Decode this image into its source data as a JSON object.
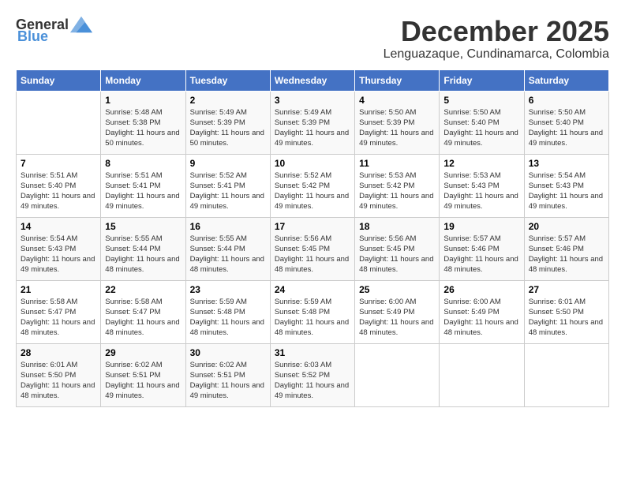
{
  "header": {
    "logo_general": "General",
    "logo_blue": "Blue",
    "month": "December 2025",
    "location": "Lenguazaque, Cundinamarca, Colombia"
  },
  "weekdays": [
    "Sunday",
    "Monday",
    "Tuesday",
    "Wednesday",
    "Thursday",
    "Friday",
    "Saturday"
  ],
  "weeks": [
    [
      {
        "day": "",
        "sunrise": "",
        "sunset": "",
        "daylight": ""
      },
      {
        "day": "1",
        "sunrise": "Sunrise: 5:48 AM",
        "sunset": "Sunset: 5:38 PM",
        "daylight": "Daylight: 11 hours and 50 minutes."
      },
      {
        "day": "2",
        "sunrise": "Sunrise: 5:49 AM",
        "sunset": "Sunset: 5:39 PM",
        "daylight": "Daylight: 11 hours and 50 minutes."
      },
      {
        "day": "3",
        "sunrise": "Sunrise: 5:49 AM",
        "sunset": "Sunset: 5:39 PM",
        "daylight": "Daylight: 11 hours and 49 minutes."
      },
      {
        "day": "4",
        "sunrise": "Sunrise: 5:50 AM",
        "sunset": "Sunset: 5:39 PM",
        "daylight": "Daylight: 11 hours and 49 minutes."
      },
      {
        "day": "5",
        "sunrise": "Sunrise: 5:50 AM",
        "sunset": "Sunset: 5:40 PM",
        "daylight": "Daylight: 11 hours and 49 minutes."
      },
      {
        "day": "6",
        "sunrise": "Sunrise: 5:50 AM",
        "sunset": "Sunset: 5:40 PM",
        "daylight": "Daylight: 11 hours and 49 minutes."
      }
    ],
    [
      {
        "day": "7",
        "sunrise": "Sunrise: 5:51 AM",
        "sunset": "Sunset: 5:40 PM",
        "daylight": "Daylight: 11 hours and 49 minutes."
      },
      {
        "day": "8",
        "sunrise": "Sunrise: 5:51 AM",
        "sunset": "Sunset: 5:41 PM",
        "daylight": "Daylight: 11 hours and 49 minutes."
      },
      {
        "day": "9",
        "sunrise": "Sunrise: 5:52 AM",
        "sunset": "Sunset: 5:41 PM",
        "daylight": "Daylight: 11 hours and 49 minutes."
      },
      {
        "day": "10",
        "sunrise": "Sunrise: 5:52 AM",
        "sunset": "Sunset: 5:42 PM",
        "daylight": "Daylight: 11 hours and 49 minutes."
      },
      {
        "day": "11",
        "sunrise": "Sunrise: 5:53 AM",
        "sunset": "Sunset: 5:42 PM",
        "daylight": "Daylight: 11 hours and 49 minutes."
      },
      {
        "day": "12",
        "sunrise": "Sunrise: 5:53 AM",
        "sunset": "Sunset: 5:43 PM",
        "daylight": "Daylight: 11 hours and 49 minutes."
      },
      {
        "day": "13",
        "sunrise": "Sunrise: 5:54 AM",
        "sunset": "Sunset: 5:43 PM",
        "daylight": "Daylight: 11 hours and 49 minutes."
      }
    ],
    [
      {
        "day": "14",
        "sunrise": "Sunrise: 5:54 AM",
        "sunset": "Sunset: 5:43 PM",
        "daylight": "Daylight: 11 hours and 49 minutes."
      },
      {
        "day": "15",
        "sunrise": "Sunrise: 5:55 AM",
        "sunset": "Sunset: 5:44 PM",
        "daylight": "Daylight: 11 hours and 48 minutes."
      },
      {
        "day": "16",
        "sunrise": "Sunrise: 5:55 AM",
        "sunset": "Sunset: 5:44 PM",
        "daylight": "Daylight: 11 hours and 48 minutes."
      },
      {
        "day": "17",
        "sunrise": "Sunrise: 5:56 AM",
        "sunset": "Sunset: 5:45 PM",
        "daylight": "Daylight: 11 hours and 48 minutes."
      },
      {
        "day": "18",
        "sunrise": "Sunrise: 5:56 AM",
        "sunset": "Sunset: 5:45 PM",
        "daylight": "Daylight: 11 hours and 48 minutes."
      },
      {
        "day": "19",
        "sunrise": "Sunrise: 5:57 AM",
        "sunset": "Sunset: 5:46 PM",
        "daylight": "Daylight: 11 hours and 48 minutes."
      },
      {
        "day": "20",
        "sunrise": "Sunrise: 5:57 AM",
        "sunset": "Sunset: 5:46 PM",
        "daylight": "Daylight: 11 hours and 48 minutes."
      }
    ],
    [
      {
        "day": "21",
        "sunrise": "Sunrise: 5:58 AM",
        "sunset": "Sunset: 5:47 PM",
        "daylight": "Daylight: 11 hours and 48 minutes."
      },
      {
        "day": "22",
        "sunrise": "Sunrise: 5:58 AM",
        "sunset": "Sunset: 5:47 PM",
        "daylight": "Daylight: 11 hours and 48 minutes."
      },
      {
        "day": "23",
        "sunrise": "Sunrise: 5:59 AM",
        "sunset": "Sunset: 5:48 PM",
        "daylight": "Daylight: 11 hours and 48 minutes."
      },
      {
        "day": "24",
        "sunrise": "Sunrise: 5:59 AM",
        "sunset": "Sunset: 5:48 PM",
        "daylight": "Daylight: 11 hours and 48 minutes."
      },
      {
        "day": "25",
        "sunrise": "Sunrise: 6:00 AM",
        "sunset": "Sunset: 5:49 PM",
        "daylight": "Daylight: 11 hours and 48 minutes."
      },
      {
        "day": "26",
        "sunrise": "Sunrise: 6:00 AM",
        "sunset": "Sunset: 5:49 PM",
        "daylight": "Daylight: 11 hours and 48 minutes."
      },
      {
        "day": "27",
        "sunrise": "Sunrise: 6:01 AM",
        "sunset": "Sunset: 5:50 PM",
        "daylight": "Daylight: 11 hours and 48 minutes."
      }
    ],
    [
      {
        "day": "28",
        "sunrise": "Sunrise: 6:01 AM",
        "sunset": "Sunset: 5:50 PM",
        "daylight": "Daylight: 11 hours and 48 minutes."
      },
      {
        "day": "29",
        "sunrise": "Sunrise: 6:02 AM",
        "sunset": "Sunset: 5:51 PM",
        "daylight": "Daylight: 11 hours and 49 minutes."
      },
      {
        "day": "30",
        "sunrise": "Sunrise: 6:02 AM",
        "sunset": "Sunset: 5:51 PM",
        "daylight": "Daylight: 11 hours and 49 minutes."
      },
      {
        "day": "31",
        "sunrise": "Sunrise: 6:03 AM",
        "sunset": "Sunset: 5:52 PM",
        "daylight": "Daylight: 11 hours and 49 minutes."
      },
      {
        "day": "",
        "sunrise": "",
        "sunset": "",
        "daylight": ""
      },
      {
        "day": "",
        "sunrise": "",
        "sunset": "",
        "daylight": ""
      },
      {
        "day": "",
        "sunrise": "",
        "sunset": "",
        "daylight": ""
      }
    ]
  ]
}
